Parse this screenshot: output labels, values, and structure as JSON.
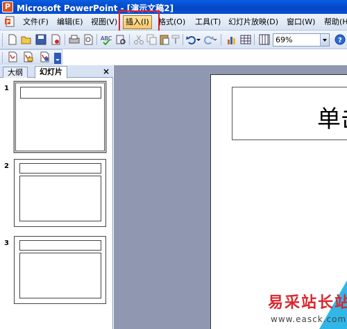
{
  "window": {
    "title": "Microsoft PowerPoint - [演示文稿2]"
  },
  "menu": {
    "items": [
      {
        "label": "文件(F)"
      },
      {
        "label": "编辑(E)"
      },
      {
        "label": "视图(V)"
      },
      {
        "label": "插入(I)",
        "active": true
      },
      {
        "label": "格式(O)"
      },
      {
        "label": "工具(T)"
      },
      {
        "label": "幻灯片放映(D)"
      },
      {
        "label": "窗口(W)"
      },
      {
        "label": "帮助(H)"
      }
    ],
    "highlight_color": "#e02020"
  },
  "toolbar": {
    "zoom_value": "69%",
    "icons": [
      "new-icon",
      "open-icon",
      "save-icon",
      "permission-icon",
      "print-icon",
      "print-preview-icon",
      "spelling-icon",
      "research-icon",
      "cut-icon",
      "copy-icon",
      "paste-icon",
      "format-painter-icon",
      "undo-icon",
      "redo-icon",
      "insert-chart-icon",
      "insert-table-icon",
      "grid-icon",
      "help-icon"
    ]
  },
  "toolbar2": {
    "icons": [
      "pdf-convert-icon",
      "pdf-email-icon",
      "pdf-review-icon"
    ]
  },
  "left_pane": {
    "tabs": [
      {
        "label": "大纲"
      },
      {
        "label": "幻灯片",
        "selected": true
      }
    ],
    "close_glyph": "×",
    "slides": [
      {
        "number": "1",
        "selected": true
      },
      {
        "number": "2"
      },
      {
        "number": "3"
      }
    ]
  },
  "slide": {
    "title_text": "单击"
  },
  "watermark": {
    "text": "易采站长站",
    "url": "www.easck.com"
  }
}
